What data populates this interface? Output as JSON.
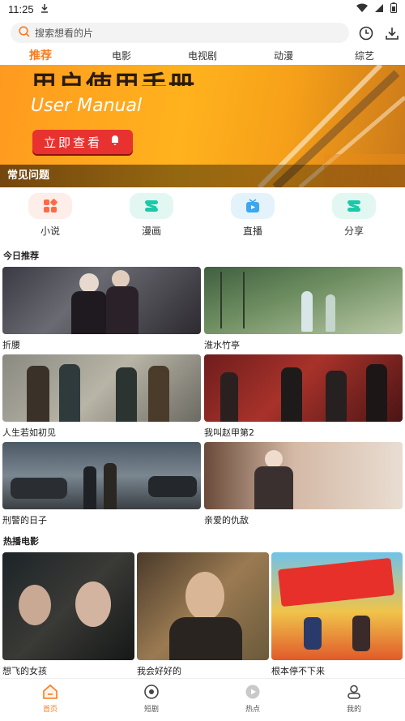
{
  "status": {
    "time": "11:25"
  },
  "search": {
    "placeholder": "搜索想看的片"
  },
  "tabs": [
    {
      "label": "推荐",
      "active": true
    },
    {
      "label": "电影"
    },
    {
      "label": "电视剧"
    },
    {
      "label": "动漫"
    },
    {
      "label": "综艺"
    }
  ],
  "banner": {
    "title_cn": "用户使用手册",
    "title_en": "User Manual",
    "cta": "立即查看",
    "caption": "常见问题"
  },
  "shortcuts": [
    {
      "label": "小说",
      "icon": "novel-icon",
      "color": "#ff6a45",
      "bg": "#fdeee9"
    },
    {
      "label": "漫画",
      "icon": "comic-icon",
      "color": "#1ac9a8",
      "bg": "#e3f7f2"
    },
    {
      "label": "直播",
      "icon": "live-icon",
      "color": "#3aa7ee",
      "bg": "#e4f2fc"
    },
    {
      "label": "分享",
      "icon": "share-icon",
      "color": "#1ac9a8",
      "bg": "#e3f7f2"
    }
  ],
  "today": {
    "title": "今日推荐",
    "items": [
      {
        "title": "折腰"
      },
      {
        "title": "淮水竹亭"
      },
      {
        "title": "人生若如初见"
      },
      {
        "title": "我叫赵甲第2"
      },
      {
        "title": "刑警的日子"
      },
      {
        "title": "亲爱的仇敌"
      }
    ]
  },
  "hot_movies": {
    "title": "热播电影",
    "items": [
      {
        "title": "想飞的女孩"
      },
      {
        "title": "我会好好的"
      },
      {
        "title": "根本停不下来"
      }
    ]
  },
  "nav": [
    {
      "label": "首页",
      "active": true,
      "icon": "home-icon"
    },
    {
      "label": "短剧",
      "icon": "short-drama-icon"
    },
    {
      "label": "热点",
      "icon": "hot-icon"
    },
    {
      "label": "我的",
      "icon": "profile-icon"
    }
  ],
  "colors": {
    "accent": "#ff7a1a"
  }
}
